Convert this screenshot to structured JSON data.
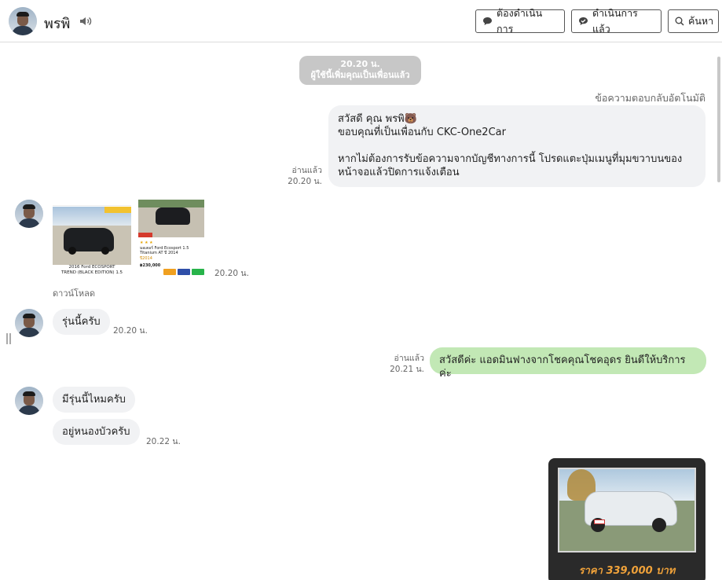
{
  "header": {
    "name": "พรพิ",
    "buttons": {
      "pending": "ต้องดำเนินการ",
      "done": "ดำเนินการแล้ว",
      "search": "ค้นหา"
    }
  },
  "system_msg": {
    "time": "20.20 น.",
    "text": "ผู้ใช้นี้เพิ่มคุณเป็นเพื่อนแล้ว"
  },
  "auto_reply_label": "ข้อความตอบกลับอัตโนมัติ",
  "welcome": {
    "line1": "สวัสดี คุณ พรพิ🐻",
    "line2": "ขอบคุณที่เป็นเพื่อนกับ CKC-One2Car",
    "line3": "หากไม่ต้องการรับข้อความจากบัญชีทางการนี้ โปรดแตะปุ่มเมนูที่มุมขวาบนของ",
    "line4": "หน้าจอแล้วปิดการแจ้งเตือน",
    "read": "อ่านแล้ว",
    "time": "20.20 น."
  },
  "images_msg": {
    "img1_caption_1": "2016 Ford ECOSPORT",
    "img1_caption_2": "TREND (BLACK EDITION) 1.5",
    "img2_caption_1": "มอเตอร์ Ford Ecosport 1.5",
    "img2_caption_2": "Titanium AT ปี 2014",
    "img2_year": "ปี2014",
    "img2_price": "฿230,000",
    "time": "20.20 น.",
    "download": "ดาวน์โหลด"
  },
  "msg1": {
    "text": "รุ่นนี้ครับ",
    "time": "20.20 น."
  },
  "msg2": {
    "text": "สวัสดีค่ะ แอดมินฟางจากโชคคุณโชคอุดร ยินดีให้บริการค่ะ",
    "read": "อ่านแล้ว",
    "time": "20.21 น."
  },
  "msg3": {
    "text": "มีรุ่นนี้ไหมครับ"
  },
  "msg4": {
    "text": "อยู่หนองบัวครับ",
    "time": "20.22 น."
  },
  "card": {
    "price": "ราคา 339,000 บาท"
  }
}
